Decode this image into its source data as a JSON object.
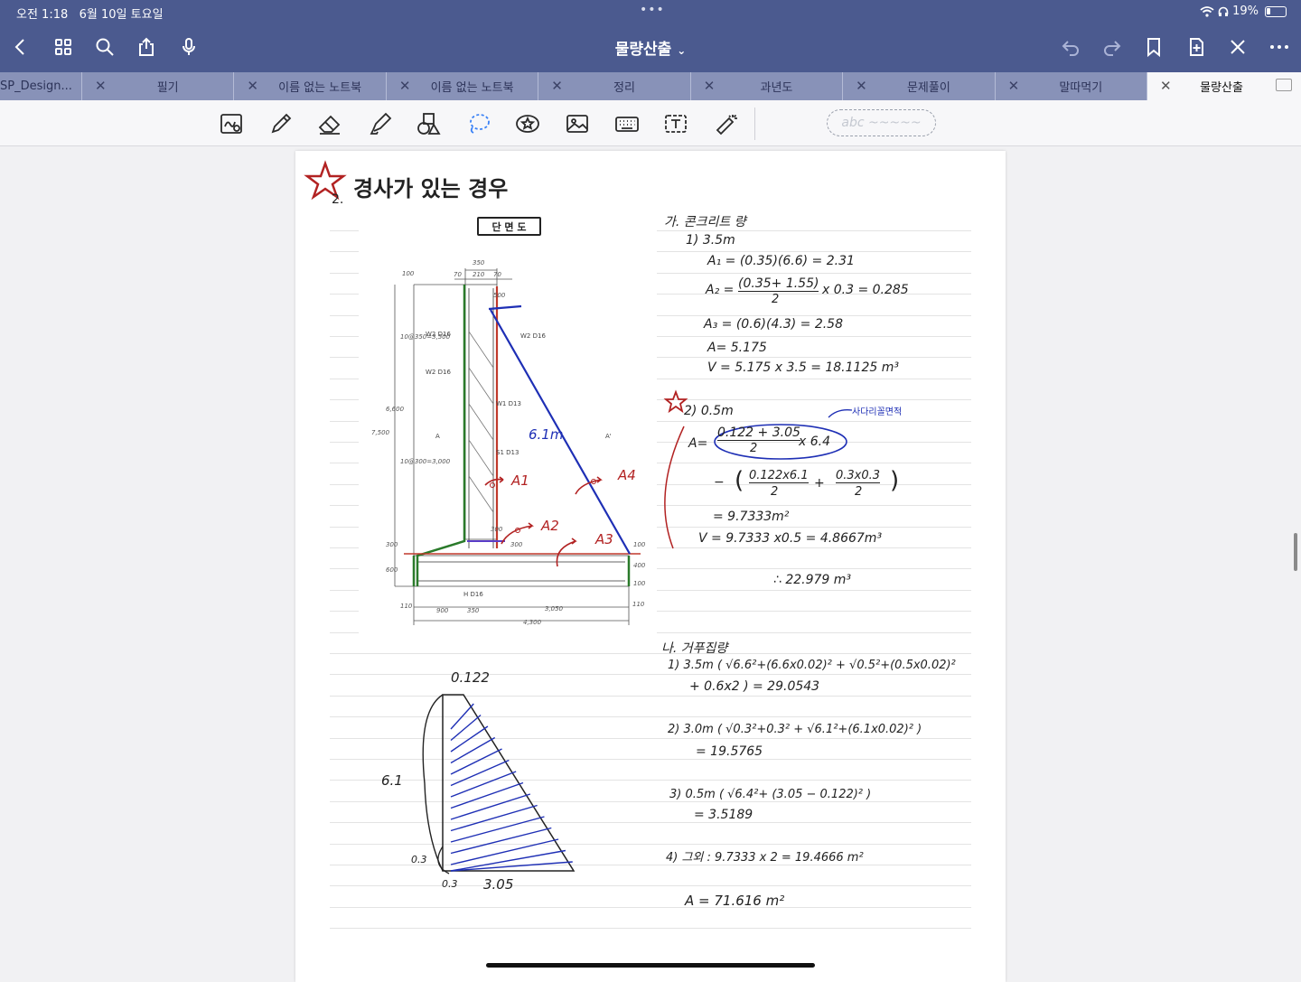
{
  "status_bar": {
    "time": "오전 1:18",
    "date": "6월 10일 토요일",
    "battery": "19%",
    "battery_level": 0.19
  },
  "toolbar": {
    "title": "물량산출",
    "title_chevron": "⌄",
    "left_icons": [
      "back-icon",
      "grid-icon",
      "search-icon",
      "share-icon",
      "microphone-icon"
    ],
    "right_icons": [
      "undo-icon",
      "redo-icon",
      "bookmark-icon",
      "add-page-icon",
      "close-icon",
      "more-icon"
    ]
  },
  "tabs": [
    {
      "label": "SP_Design...",
      "active": false
    },
    {
      "label": "필기",
      "active": false
    },
    {
      "label": "이름 없는 노트북",
      "active": false
    },
    {
      "label": "이름 없는 노트북",
      "active": false
    },
    {
      "label": "정리",
      "active": false
    },
    {
      "label": "과년도",
      "active": false
    },
    {
      "label": "문제풀이",
      "active": false
    },
    {
      "label": "말따먹기",
      "active": false
    },
    {
      "label": "물량산출",
      "active": true
    }
  ],
  "pen_tools": [
    "zoom-box-icon",
    "pen-icon",
    "eraser-icon",
    "highlighter-icon",
    "shapes-icon",
    "lasso-icon",
    "sticker-icon",
    "image-icon",
    "keyboard-icon",
    "textbox-icon",
    "laser-pointer-icon"
  ],
  "text_convert_placeholder": "abc ~~~~~",
  "note": {
    "heading_number": "2.",
    "heading": "경사가 있는 경우",
    "section_label": "단 면 도",
    "ga_title": "가. 콘크리트 량",
    "ga_1": "1) 3.5m",
    "a1": "A₁ = (0.35)(6.6) = 2.31",
    "a2_left": "A₂ =",
    "a2_num": "(0.35+ 1.55)",
    "a2_den": "2",
    "a2_right": "x 0.3  = 0.285",
    "a3": "A₃ = (0.6)(4.3) = 2.58",
    "a_sum": "A= 5.175",
    "v1": "V = 5.175 x 3.5  =  18.1125 m³",
    "ga_2": "2) 0.5m",
    "trap_note": "사다리꼴면적",
    "a_left": "A=",
    "a_num": "0.122 + 3.05",
    "a_den": "2",
    "a_mult": "x 6.4",
    "minus": "−",
    "t1_num": "0.122x6.1",
    "t1_den": "2",
    "plus": "+",
    "t2_num": "0.3x0.3",
    "t2_den": "2",
    "a_result": "= 9.7333m²",
    "v2": "V = 9.7333 x0.5 = 4.8667m³",
    "total": "∴ 22.979 m³",
    "na_title": "나. 거푸집량",
    "na_1a": "1) 3.5m ( √6.6²+(6.6x0.02)²  +  √0.5²+(0.5x0.02)²",
    "na_1b": "+ 0.6x2 )  = 29.0543",
    "na_2a": "2) 3.0m ( √0.3²+0.3²  +  √6.1²+(6.1x0.02)² )",
    "na_2b": "= 19.5765",
    "na_3a": "3) 0.5m ( √6.4²+ (3.05 − 0.122)² )",
    "na_3b": "= 3.5189",
    "na_4": "4) 그외  :    9.7333 x 2  = 19.4666 m²",
    "na_total": "A = 71.616 m²",
    "sketch_top": "0.122",
    "sketch_left": "6.1",
    "sketch_03a": "0.3",
    "sketch_03b": "0.3",
    "sketch_305": "3.05",
    "drawing_labels": {
      "a1": "A1",
      "a2": "A2",
      "a3": "A3",
      "a4": "A4",
      "slope": "6.1m",
      "dim_350": "350",
      "dim_70a": "70",
      "dim_210": "210",
      "dim_70b": "70",
      "dim_100": "100",
      "dim_500": "500",
      "dim_7500": "7,500",
      "dim_6600": "6,600",
      "dim_300a": "300",
      "dim_600": "600",
      "dim_110a": "110",
      "dim_900": "900",
      "dim_350b": "350",
      "dim_3050": "3,050",
      "dim_4300": "4,300",
      "dim_110b": "110",
      "dim_300b": "300",
      "dim_300c": "300",
      "dim_100b": "100",
      "dim_400": "400",
      "dim_100c": "100",
      "dim_v1": "10@350=3,500",
      "dim_v2": "10@300=3,000",
      "w2a": "W2 D16",
      "w2b": "W2 D16",
      "w2c": "W2 D16",
      "w1": "W1 D13",
      "s1": "S1 D13",
      "h": "H D16",
      "sec_a1": "A",
      "sec_a2": "A'"
    }
  }
}
